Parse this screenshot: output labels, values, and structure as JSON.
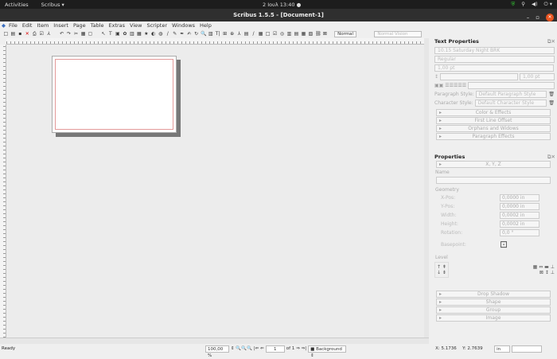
{
  "topbar": {
    "activities": "Activities",
    "app": "Scribus ▾",
    "clock": "2 Ιουλ 13:40 ●",
    "tray": [
      "shield-icon",
      "network-icon",
      "volume-icon",
      "power-icon"
    ]
  },
  "window": {
    "title": "Scribus 1.5.5 - [Document-1]"
  },
  "menu": [
    "File",
    "Edit",
    "Item",
    "Insert",
    "Page",
    "Table",
    "Extras",
    "View",
    "Scripter",
    "Windows",
    "Help"
  ],
  "toolbar": {
    "icons": [
      "□",
      "▤",
      "▪",
      "✕",
      "⎙",
      "☑",
      "⅄",
      "↶",
      "↷",
      "✂",
      "▦",
      "▢",
      "↖",
      "T",
      "▣",
      "✿",
      "▥",
      "▦",
      "★",
      "◐",
      "◍",
      "/",
      "✎",
      "✒",
      "✍",
      "↻",
      "🔍",
      "▥",
      "T|",
      "⊞",
      "⊕",
      "⅄",
      "▤",
      "/",
      "▦",
      "□",
      "☑",
      "◎",
      "▥",
      "▤",
      "▦",
      "▧",
      "⛓",
      "⊠"
    ],
    "mode": "Normal",
    "vision": "Normal Vision"
  },
  "text_properties": {
    "title": "Text Properties",
    "font": "10.15 Saturday Night BRK",
    "style": "Regular",
    "size": "1,00 pt",
    "line_spacing": "1,00 pt",
    "paragraph_style_label": "Paragraph Style:",
    "paragraph_style": "Default Paragraph Style",
    "character_style_label": "Character Style:",
    "character_style": "Default Character Style",
    "sections": [
      "Color & Effects",
      "First Line Offset",
      "Orphans and Widows",
      "Paragraph Effects"
    ]
  },
  "properties": {
    "title": "Properties",
    "xyz": "X, Y, Z",
    "name_label": "Name",
    "geometry_label": "Geometry",
    "fields": [
      {
        "label": "X-Pos:",
        "value": "0,0000 in"
      },
      {
        "label": "Y-Pos:",
        "value": "0,0000 in"
      },
      {
        "label": "Width:",
        "value": "0,0002 in"
      },
      {
        "label": "Height:",
        "value": "0,0002 in"
      },
      {
        "label": "Rotation:",
        "value": "0,0 °"
      }
    ],
    "basepoint_label": "Basepoint:",
    "level_label": "Level",
    "sections": [
      "Drop Shadow",
      "Shape",
      "Group",
      "Image"
    ]
  },
  "status": {
    "text": "Ready",
    "zoom": "100,00 %",
    "page": "1",
    "of_pages": "of 1",
    "layer": "Background",
    "x": "X: 5.1736",
    "y": "Y: 2.7639",
    "unit": "in"
  }
}
